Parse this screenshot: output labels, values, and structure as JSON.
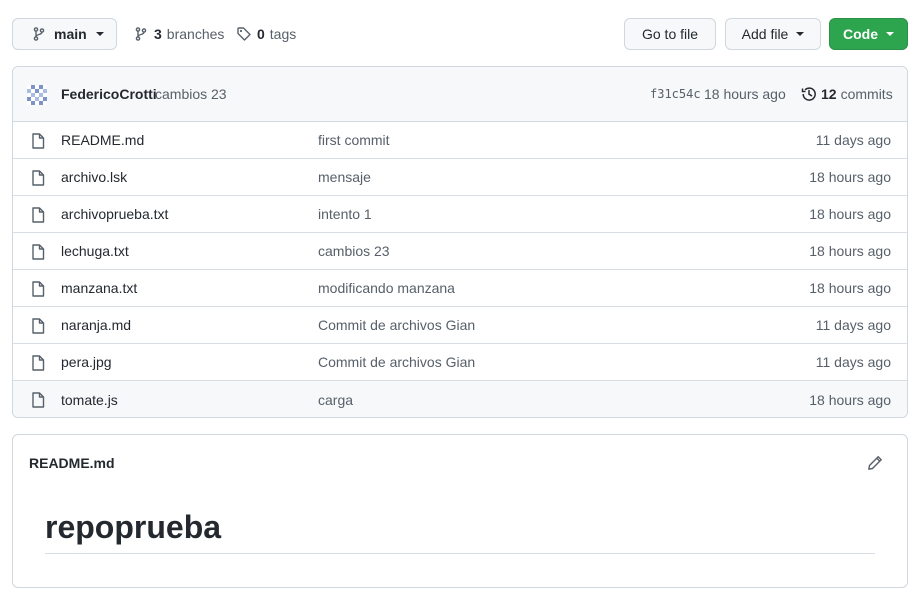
{
  "toolbar": {
    "branch_name": "main",
    "branches_count": "3",
    "branches_label": "branches",
    "tags_count": "0",
    "tags_label": "tags",
    "go_to_file": "Go to file",
    "add_file": "Add file",
    "code": "Code"
  },
  "commit": {
    "author": "FedericoCrotti",
    "message": "cambios 23",
    "sha": "f31c54c",
    "time": "18 hours ago",
    "commits_count": "12",
    "commits_label": "commits"
  },
  "files": [
    {
      "name": "README.md",
      "message": "first commit",
      "time": "11 days ago"
    },
    {
      "name": "archivo.lsk",
      "message": "mensaje",
      "time": "18 hours ago"
    },
    {
      "name": "archivoprueba.txt",
      "message": "intento 1",
      "time": "18 hours ago"
    },
    {
      "name": "lechuga.txt",
      "message": "cambios 23",
      "time": "18 hours ago"
    },
    {
      "name": "manzana.txt",
      "message": "modificando manzana",
      "time": "18 hours ago"
    },
    {
      "name": "naranja.md",
      "message": "Commit de archivos Gian",
      "time": "11 days ago"
    },
    {
      "name": "pera.jpg",
      "message": "Commit de archivos Gian",
      "time": "11 days ago"
    },
    {
      "name": "tomate.js",
      "message": "carga",
      "time": "18 hours ago"
    }
  ],
  "readme": {
    "title": "README.md",
    "heading": "repoprueba"
  },
  "icons": {
    "branch": "git-branch-icon",
    "tag": "tag-icon",
    "history": "history-icon",
    "file": "file-icon",
    "edit": "pencil-icon"
  },
  "colors": {
    "code_button": "#2da44e",
    "border": "#d0d7de",
    "header_bg": "#f6f8fa"
  }
}
